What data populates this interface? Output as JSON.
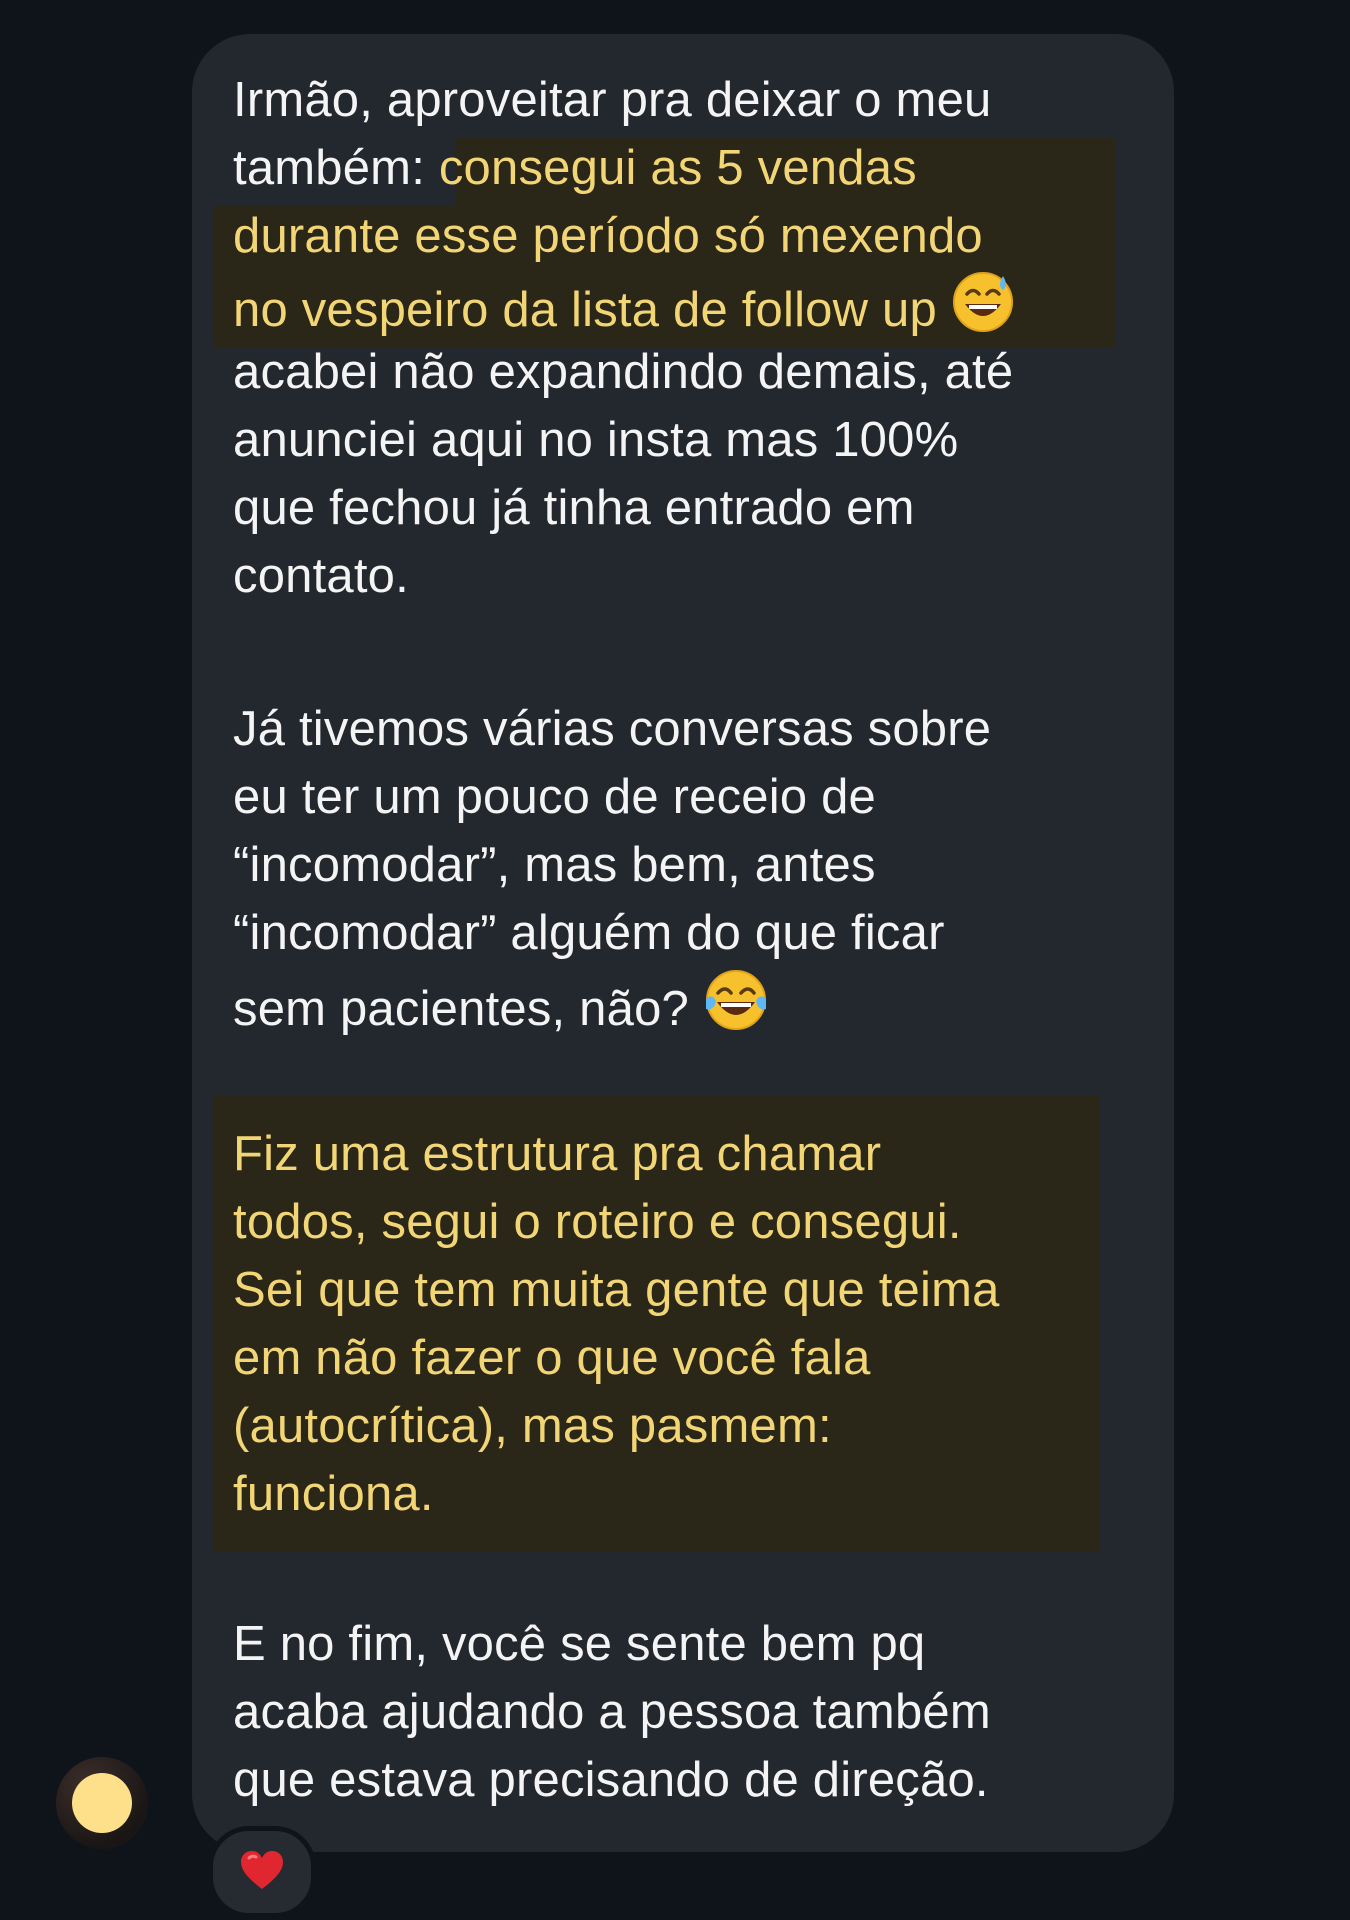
{
  "message": {
    "p1": {
      "line1": "Irmão, aproveitar pra deixar o meu",
      "line2_plain": "também:",
      "line2_hl": "consegui as 5 vendas",
      "line3_hl": "durante esse período só mexendo",
      "line4_hl": "no vespeiro da lista de follow up",
      "line5": "acabei não expandindo demais, até",
      "line6": "anunciei aqui no insta mas 100%",
      "line7": "que fechou já tinha entrado em",
      "line8": "contato.",
      "emoji": "sweat-smile-emoji"
    },
    "p2": {
      "line1": "Já tivemos várias conversas sobre",
      "line2": "eu ter um pouco de receio de",
      "line3": "“incomodar”, mas bem, antes",
      "line4": "“incomodar” alguém do que ficar",
      "line5": "sem pacientes, não?",
      "emoji": "tears-of-joy-emoji"
    },
    "p3": {
      "line1": "Fiz uma estrutura pra chamar",
      "line2": "todos, segui o roteiro e consegui.",
      "line3": "Sei que tem muita gente que teima",
      "line4": "em não fazer o que você fala",
      "line5": "(autocrítica), mas pasmem:",
      "line6": "funciona."
    },
    "p4": {
      "line1": "E no fim, você se sente bem pq",
      "line2": "acaba ajudando a pessoa também",
      "line3": "que estava precisando de direção."
    }
  },
  "reaction": {
    "icon": "red-heart-icon"
  },
  "avatar": {
    "icon": "profile-avatar"
  },
  "colors": {
    "background": "#0f141b",
    "bubble": "#23272e",
    "text": "#f4f4f4",
    "highlight_text": "#f2d575",
    "highlight_bg": "#2a2618",
    "heart": "#e0262f"
  }
}
